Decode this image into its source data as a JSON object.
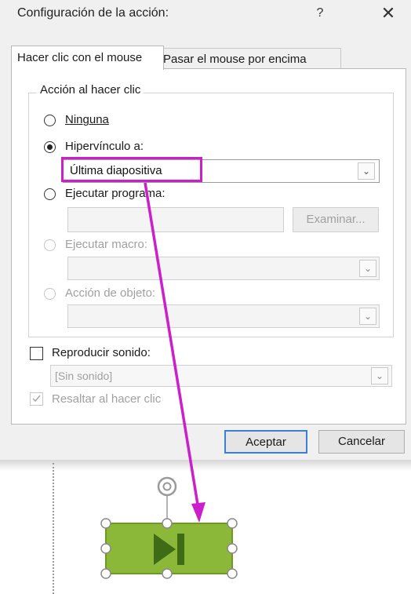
{
  "dialog": {
    "title": "Configuración de la acción:",
    "help": "?",
    "close": "✕",
    "tabs": [
      {
        "label": "Hacer clic con el mouse"
      },
      {
        "label": "Pasar el mouse por encima"
      }
    ],
    "group_label": "Acción al hacer clic",
    "options": {
      "none": "Ninguna",
      "hyperlink": "Hipervínculo a:",
      "run_program": "Ejecutar programa:",
      "run_macro": "Ejecutar macro:",
      "object_action": "Acción de objeto:"
    },
    "hyperlink_value": "Última diapositiva",
    "browse_label": "Examinar...",
    "play_sound_label": "Reproducir sonido:",
    "sound_value": "[Sin sonido]",
    "highlight_label": "Resaltar al hacer clic",
    "ok_label": "Aceptar",
    "cancel_label": "Cancelar"
  },
  "colors": {
    "annotation": "#cc1fcc",
    "button_fill": "#8cb83a",
    "button_border": "#6e9a24",
    "icon": "#3f6b17",
    "primary_focus": "#3c7fd6"
  },
  "icons": {
    "selected_radio": "radio-filled",
    "rotate_handle": "rotate-icon",
    "button_glyph": "end-play-icon"
  }
}
